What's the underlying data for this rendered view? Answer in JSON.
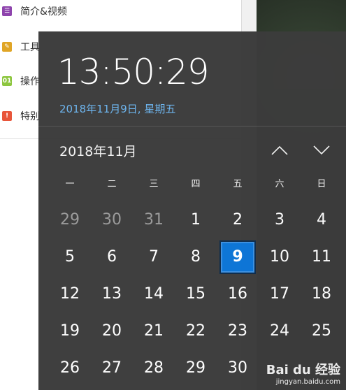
{
  "sidebar": {
    "items": [
      {
        "label": "简介&视频",
        "icon": "list-icon",
        "color": "#8e44ad"
      },
      {
        "label": "工具",
        "icon": "wrench-icon",
        "color": "#e0a526"
      },
      {
        "label": "操作",
        "icon": "steps-icon",
        "icon_text": "01",
        "color": "#8dc63f"
      },
      {
        "label": "特别",
        "icon": "alert-icon",
        "icon_text": "!",
        "color": "#e8563b"
      }
    ]
  },
  "flyout": {
    "time": "13:50:29",
    "date": "2018年11月9日, 星期五",
    "month": "2018年11月",
    "prev_icon": "chevron-up-icon",
    "next_icon": "chevron-down-icon",
    "accent": "#0b74d6",
    "date_color": "#6cb4ee",
    "weekdays": [
      "一",
      "二",
      "三",
      "四",
      "五",
      "六",
      "日"
    ],
    "days": [
      {
        "d": "29",
        "other": true
      },
      {
        "d": "30",
        "other": true
      },
      {
        "d": "31",
        "other": true
      },
      {
        "d": "1"
      },
      {
        "d": "2"
      },
      {
        "d": "3"
      },
      {
        "d": "4"
      },
      {
        "d": "5"
      },
      {
        "d": "6"
      },
      {
        "d": "7"
      },
      {
        "d": "8"
      },
      {
        "d": "9",
        "today": true
      },
      {
        "d": "10"
      },
      {
        "d": "11"
      },
      {
        "d": "12"
      },
      {
        "d": "13"
      },
      {
        "d": "14"
      },
      {
        "d": "15"
      },
      {
        "d": "16"
      },
      {
        "d": "17"
      },
      {
        "d": "18"
      },
      {
        "d": "19"
      },
      {
        "d": "20"
      },
      {
        "d": "21"
      },
      {
        "d": "22"
      },
      {
        "d": "23"
      },
      {
        "d": "24"
      },
      {
        "d": "25"
      },
      {
        "d": "26"
      },
      {
        "d": "27"
      },
      {
        "d": "28"
      },
      {
        "d": "29"
      },
      {
        "d": "30"
      }
    ]
  },
  "watermark": {
    "logo": "Bai du 经验",
    "url": "jingyan.baidu.com"
  }
}
